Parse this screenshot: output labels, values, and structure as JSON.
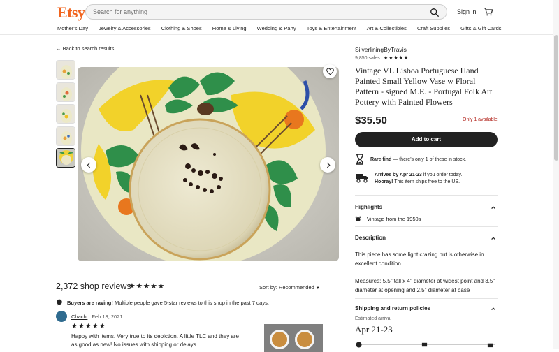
{
  "header": {
    "logo": "Etsy",
    "search_placeholder": "Search for anything",
    "signin": "Sign in",
    "categories": [
      "Mother's Day",
      "Jewelry & Accessories",
      "Clothing & Shoes",
      "Home & Living",
      "Wedding & Party",
      "Toys & Entertainment",
      "Art & Collectibles",
      "Craft Supplies",
      "Gifts & Gift Cards"
    ]
  },
  "listing": {
    "back_link": "Back to search results",
    "shop_name": "SilverliningByTravis",
    "sales": "9,850 sales",
    "shop_stars": "★★★★★",
    "title": "Vintage VL Lisboa Portuguese Hand Painted Small Yellow Vase w Floral Pattern - signed M.E. - Portugal Folk Art Pottery with Painted Flowers",
    "price": "$35.50",
    "availability": "Only 1 available",
    "add_to_cart": "Add to cart",
    "rare_find_bold": "Rare find",
    "rare_find_text": " — there's only 1 of these in stock.",
    "arrives_bold": "Arrives by Apr 21-23",
    "arrives_text": " if you order today.",
    "hooray_bold": "Hooray!",
    "hooray_text": " This item ships free to the US.",
    "highlights_title": "Highlights",
    "highlight_vintage": "Vintage from the 1950s",
    "description_title": "Description",
    "description_p1": "This piece has some light crazing but is otherwise in excellent condition.",
    "description_p2": "Measures: 5.5\" tall x 4\" diameter at widest point and 3.5\" diameter at opening and 2.5\" diameter at base",
    "shipping_title": "Shipping and return policies",
    "estimated_arrival_label": "Estimated arrival",
    "estimated_arrival_date": "Apr 21-23"
  },
  "reviews": {
    "title": "2,372 shop reviews",
    "stars": "★★★★★",
    "sort_label": "Sort by:",
    "sort_value": "Recommended",
    "raving_bold": "Buyers are raving!",
    "raving_text": " Multiple people gave 5-star reviews to this shop in the past 7 days.",
    "reviewer_name": "Chachi",
    "review_date": "Feb 13, 2021",
    "review_stars": "★★★★★",
    "review_text": "Happy with items. Very true to its depiction. A little TLC and they are as good as new! No issues with shipping or delays."
  },
  "colors": {
    "brand": "#f1641e",
    "button": "#222222",
    "alert": "#b3261e"
  }
}
